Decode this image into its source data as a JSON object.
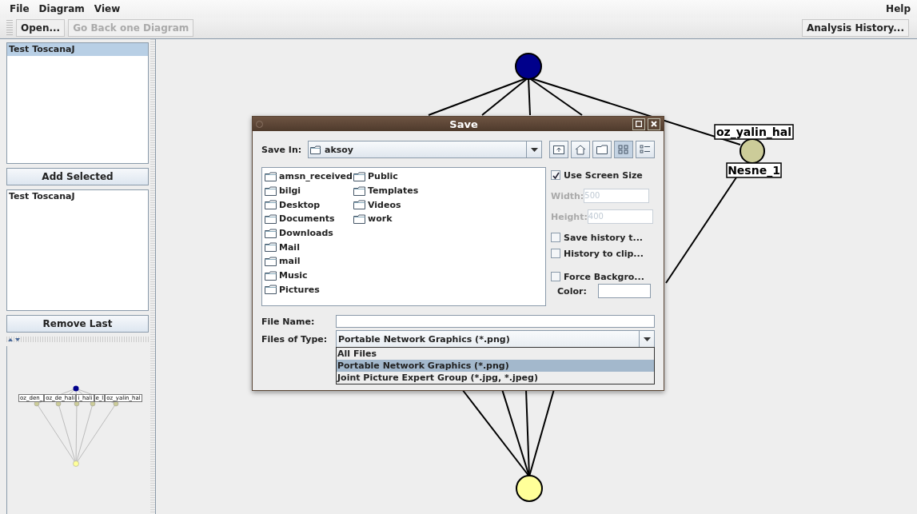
{
  "menu": {
    "left": [
      "File",
      "Diagram",
      "View"
    ],
    "right": "Help"
  },
  "toolbar": {
    "buttons": [
      {
        "label": "Open...",
        "disabled": false
      },
      {
        "label": "Go Back one Diagram",
        "disabled": true
      }
    ],
    "right_button": "Analysis History..."
  },
  "left_panel": {
    "top_list": [
      {
        "label": "Test ToscanaJ",
        "selected": true
      }
    ],
    "add_button": "Add Selected",
    "bottom_list": [
      {
        "label": "Test ToscanaJ",
        "selected": false
      }
    ],
    "remove_button": "Remove Last",
    "overview_labels": [
      "oz_den_",
      "oz_de_hali",
      "i_hali",
      "e_l",
      "oz_yalin_hal"
    ]
  },
  "diagram": {
    "nodes": [
      {
        "color": "#00008b"
      },
      {
        "color": "#cccc99",
        "labels": [
          "oz_yalin_hal",
          "Nesne_1"
        ]
      },
      {
        "color": "#ffff99"
      }
    ]
  },
  "dialog": {
    "title": "Save",
    "save_in": {
      "label": "Save In:",
      "value": "aksoy"
    },
    "files": [
      [
        "amsn_received",
        "bilgi",
        "Desktop",
        "Documents",
        "Downloads",
        "Mail",
        "mail",
        "Music",
        "Pictures"
      ],
      [
        "Public",
        "Templates",
        "Videos",
        "work"
      ]
    ],
    "options": [
      {
        "kind": "checkbox",
        "label": "Use Screen Size",
        "checked": true
      },
      {
        "kind": "field",
        "label": "Width:",
        "value": "500",
        "disabled": true
      },
      {
        "kind": "field",
        "label": "Height:",
        "value": "400",
        "disabled": true
      },
      {
        "kind": "checkbox",
        "label": "Save history t...",
        "checked": false
      },
      {
        "kind": "checkbox",
        "label": "History to clip...",
        "checked": false
      },
      {
        "kind": "checkbox",
        "label": "Force Backgro...",
        "checked": false
      },
      {
        "kind": "color",
        "label": "Color:"
      }
    ],
    "file_name": {
      "label": "File Name:"
    },
    "files_of_type": {
      "label": "Files of Type:",
      "value": "Portable Network Graphics (*.png)"
    },
    "type_options": [
      {
        "label": "All Files",
        "selected": false
      },
      {
        "label": "Portable Network Graphics (*.png)",
        "selected": true
      },
      {
        "label": "Joint Picture Expert Group (*.jpg, *.jpeg)",
        "selected": false
      }
    ]
  }
}
